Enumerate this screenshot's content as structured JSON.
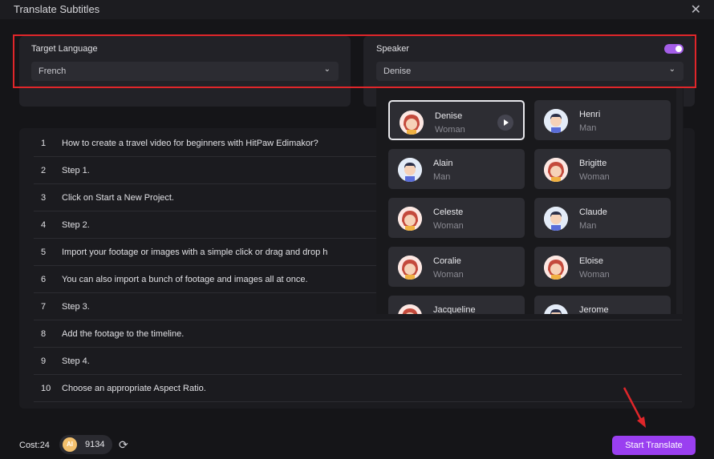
{
  "window": {
    "title": "Translate Subtitles",
    "close_glyph": "✕"
  },
  "target_language": {
    "label": "Target Language",
    "value": "French"
  },
  "speaker": {
    "label": "Speaker",
    "value": "Denise",
    "toggle_on": true
  },
  "speakers": [
    {
      "name": "Denise",
      "gender": "Woman",
      "selected": true
    },
    {
      "name": "Henri",
      "gender": "Man"
    },
    {
      "name": "Alain",
      "gender": "Man"
    },
    {
      "name": "Brigitte",
      "gender": "Woman"
    },
    {
      "name": "Celeste",
      "gender": "Woman"
    },
    {
      "name": "Claude",
      "gender": "Man"
    },
    {
      "name": "Coralie",
      "gender": "Woman"
    },
    {
      "name": "Eloise",
      "gender": "Woman"
    },
    {
      "name": "Jacqueline",
      "gender": ""
    },
    {
      "name": "Jerome",
      "gender": ""
    }
  ],
  "subtitles": [
    {
      "num": "1",
      "text": "How to create a travel video for beginners with HitPaw Edimakor?"
    },
    {
      "num": "2",
      "text": "Step 1."
    },
    {
      "num": "3",
      "text": "Click on Start a New Project."
    },
    {
      "num": "4",
      "text": "Step 2."
    },
    {
      "num": "5",
      "text": "Import your footage or images with a simple click or drag and drop h"
    },
    {
      "num": "6",
      "text": "You can also import a bunch of footage and images all at once."
    },
    {
      "num": "7",
      "text": "Step 3."
    },
    {
      "num": "8",
      "text": "Add the footage to the timeline."
    },
    {
      "num": "9",
      "text": "Step 4."
    },
    {
      "num": "10",
      "text": "Choose an appropriate Aspect Ratio."
    }
  ],
  "footer": {
    "cost_label": "Cost:",
    "cost_value": "24",
    "coin_label": "AI",
    "credits": "9134",
    "start_button": "Start Translate"
  },
  "colors": {
    "accent": "#9a3ff0",
    "highlight_border": "#e0262a",
    "toggle": "#a45ee8"
  }
}
